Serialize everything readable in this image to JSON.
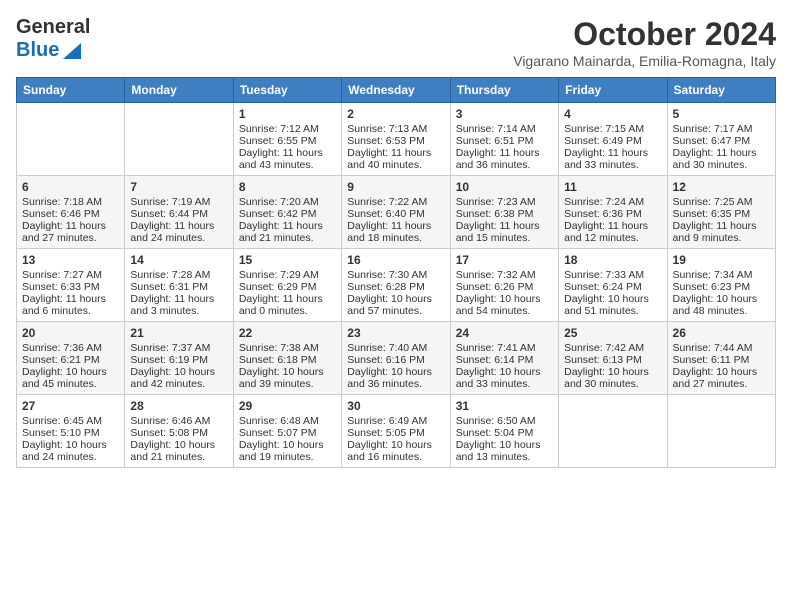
{
  "header": {
    "logo_line1": "General",
    "logo_line2": "Blue",
    "month": "October 2024",
    "location": "Vigarano Mainarda, Emilia-Romagna, Italy"
  },
  "days_of_week": [
    "Sunday",
    "Monday",
    "Tuesday",
    "Wednesday",
    "Thursday",
    "Friday",
    "Saturday"
  ],
  "weeks": [
    [
      {
        "day": "",
        "info": ""
      },
      {
        "day": "",
        "info": ""
      },
      {
        "day": "1",
        "info": "Sunrise: 7:12 AM\nSunset: 6:55 PM\nDaylight: 11 hours and 43 minutes."
      },
      {
        "day": "2",
        "info": "Sunrise: 7:13 AM\nSunset: 6:53 PM\nDaylight: 11 hours and 40 minutes."
      },
      {
        "day": "3",
        "info": "Sunrise: 7:14 AM\nSunset: 6:51 PM\nDaylight: 11 hours and 36 minutes."
      },
      {
        "day": "4",
        "info": "Sunrise: 7:15 AM\nSunset: 6:49 PM\nDaylight: 11 hours and 33 minutes."
      },
      {
        "day": "5",
        "info": "Sunrise: 7:17 AM\nSunset: 6:47 PM\nDaylight: 11 hours and 30 minutes."
      }
    ],
    [
      {
        "day": "6",
        "info": "Sunrise: 7:18 AM\nSunset: 6:46 PM\nDaylight: 11 hours and 27 minutes."
      },
      {
        "day": "7",
        "info": "Sunrise: 7:19 AM\nSunset: 6:44 PM\nDaylight: 11 hours and 24 minutes."
      },
      {
        "day": "8",
        "info": "Sunrise: 7:20 AM\nSunset: 6:42 PM\nDaylight: 11 hours and 21 minutes."
      },
      {
        "day": "9",
        "info": "Sunrise: 7:22 AM\nSunset: 6:40 PM\nDaylight: 11 hours and 18 minutes."
      },
      {
        "day": "10",
        "info": "Sunrise: 7:23 AM\nSunset: 6:38 PM\nDaylight: 11 hours and 15 minutes."
      },
      {
        "day": "11",
        "info": "Sunrise: 7:24 AM\nSunset: 6:36 PM\nDaylight: 11 hours and 12 minutes."
      },
      {
        "day": "12",
        "info": "Sunrise: 7:25 AM\nSunset: 6:35 PM\nDaylight: 11 hours and 9 minutes."
      }
    ],
    [
      {
        "day": "13",
        "info": "Sunrise: 7:27 AM\nSunset: 6:33 PM\nDaylight: 11 hours and 6 minutes."
      },
      {
        "day": "14",
        "info": "Sunrise: 7:28 AM\nSunset: 6:31 PM\nDaylight: 11 hours and 3 minutes."
      },
      {
        "day": "15",
        "info": "Sunrise: 7:29 AM\nSunset: 6:29 PM\nDaylight: 11 hours and 0 minutes."
      },
      {
        "day": "16",
        "info": "Sunrise: 7:30 AM\nSunset: 6:28 PM\nDaylight: 10 hours and 57 minutes."
      },
      {
        "day": "17",
        "info": "Sunrise: 7:32 AM\nSunset: 6:26 PM\nDaylight: 10 hours and 54 minutes."
      },
      {
        "day": "18",
        "info": "Sunrise: 7:33 AM\nSunset: 6:24 PM\nDaylight: 10 hours and 51 minutes."
      },
      {
        "day": "19",
        "info": "Sunrise: 7:34 AM\nSunset: 6:23 PM\nDaylight: 10 hours and 48 minutes."
      }
    ],
    [
      {
        "day": "20",
        "info": "Sunrise: 7:36 AM\nSunset: 6:21 PM\nDaylight: 10 hours and 45 minutes."
      },
      {
        "day": "21",
        "info": "Sunrise: 7:37 AM\nSunset: 6:19 PM\nDaylight: 10 hours and 42 minutes."
      },
      {
        "day": "22",
        "info": "Sunrise: 7:38 AM\nSunset: 6:18 PM\nDaylight: 10 hours and 39 minutes."
      },
      {
        "day": "23",
        "info": "Sunrise: 7:40 AM\nSunset: 6:16 PM\nDaylight: 10 hours and 36 minutes."
      },
      {
        "day": "24",
        "info": "Sunrise: 7:41 AM\nSunset: 6:14 PM\nDaylight: 10 hours and 33 minutes."
      },
      {
        "day": "25",
        "info": "Sunrise: 7:42 AM\nSunset: 6:13 PM\nDaylight: 10 hours and 30 minutes."
      },
      {
        "day": "26",
        "info": "Sunrise: 7:44 AM\nSunset: 6:11 PM\nDaylight: 10 hours and 27 minutes."
      }
    ],
    [
      {
        "day": "27",
        "info": "Sunrise: 6:45 AM\nSunset: 5:10 PM\nDaylight: 10 hours and 24 minutes."
      },
      {
        "day": "28",
        "info": "Sunrise: 6:46 AM\nSunset: 5:08 PM\nDaylight: 10 hours and 21 minutes."
      },
      {
        "day": "29",
        "info": "Sunrise: 6:48 AM\nSunset: 5:07 PM\nDaylight: 10 hours and 19 minutes."
      },
      {
        "day": "30",
        "info": "Sunrise: 6:49 AM\nSunset: 5:05 PM\nDaylight: 10 hours and 16 minutes."
      },
      {
        "day": "31",
        "info": "Sunrise: 6:50 AM\nSunset: 5:04 PM\nDaylight: 10 hours and 13 minutes."
      },
      {
        "day": "",
        "info": ""
      },
      {
        "day": "",
        "info": ""
      }
    ]
  ]
}
